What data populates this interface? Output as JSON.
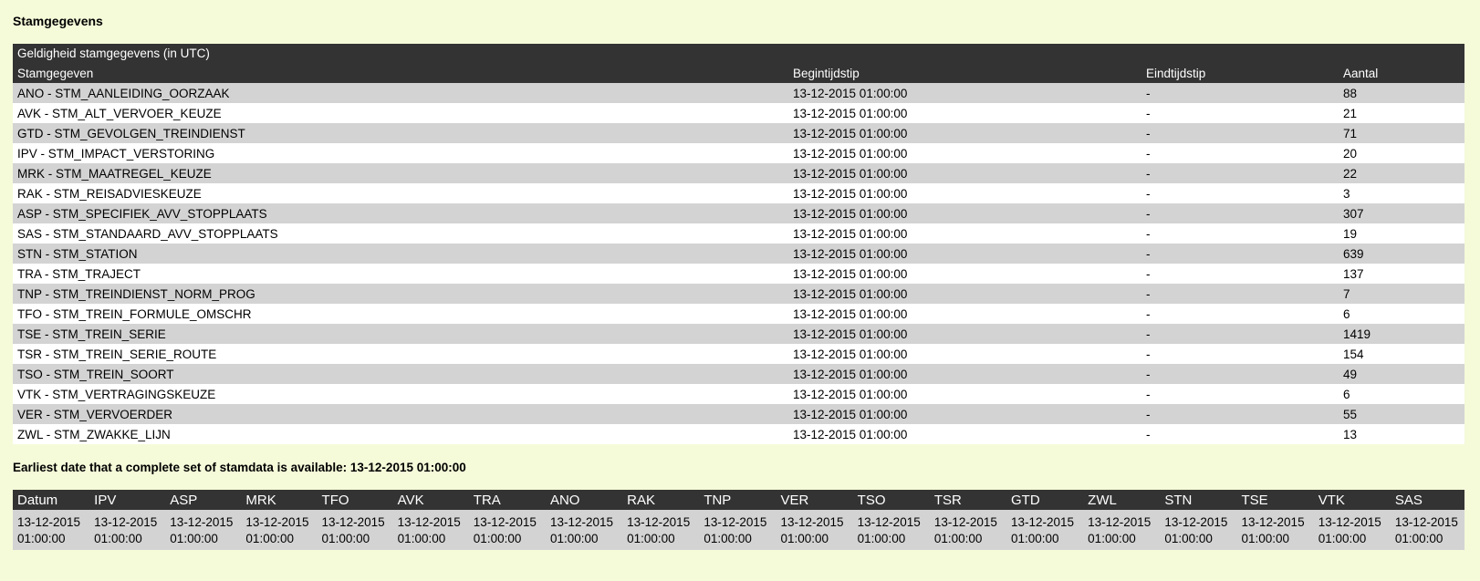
{
  "page_title": "Stamgegevens",
  "validity_table": {
    "caption": "Geldigheid stamgegevens (in UTC)",
    "columns": [
      "Stamgegeven",
      "Begintijdstip",
      "Eindtijdstip",
      "Aantal"
    ],
    "rows": [
      [
        "ANO - STM_AANLEIDING_OORZAAK",
        "13-12-2015 01:00:00",
        "-",
        "88"
      ],
      [
        "AVK - STM_ALT_VERVOER_KEUZE",
        "13-12-2015 01:00:00",
        "-",
        "21"
      ],
      [
        "GTD - STM_GEVOLGEN_TREINDIENST",
        "13-12-2015 01:00:00",
        "-",
        "71"
      ],
      [
        "IPV - STM_IMPACT_VERSTORING",
        "13-12-2015 01:00:00",
        "-",
        "20"
      ],
      [
        "MRK - STM_MAATREGEL_KEUZE",
        "13-12-2015 01:00:00",
        "-",
        "22"
      ],
      [
        "RAK - STM_REISADVIESKEUZE",
        "13-12-2015 01:00:00",
        "-",
        "3"
      ],
      [
        "ASP - STM_SPECIFIEK_AVV_STOPPLAATS",
        "13-12-2015 01:00:00",
        "-",
        "307"
      ],
      [
        "SAS - STM_STANDAARD_AVV_STOPPLAATS",
        "13-12-2015 01:00:00",
        "-",
        "19"
      ],
      [
        "STN - STM_STATION",
        "13-12-2015 01:00:00",
        "-",
        "639"
      ],
      [
        "TRA - STM_TRAJECT",
        "13-12-2015 01:00:00",
        "-",
        "137"
      ],
      [
        "TNP - STM_TREINDIENST_NORM_PROG",
        "13-12-2015 01:00:00",
        "-",
        "7"
      ],
      [
        "TFO - STM_TREIN_FORMULE_OMSCHR",
        "13-12-2015 01:00:00",
        "-",
        "6"
      ],
      [
        "TSE - STM_TREIN_SERIE",
        "13-12-2015 01:00:00",
        "-",
        "1419"
      ],
      [
        "TSR - STM_TREIN_SERIE_ROUTE",
        "13-12-2015 01:00:00",
        "-",
        "154"
      ],
      [
        "TSO - STM_TREIN_SOORT",
        "13-12-2015 01:00:00",
        "-",
        "49"
      ],
      [
        "VTK - STM_VERTRAGINGSKEUZE",
        "13-12-2015 01:00:00",
        "-",
        "6"
      ],
      [
        "VER - STM_VERVOERDER",
        "13-12-2015 01:00:00",
        "-",
        "55"
      ],
      [
        "ZWL - STM_ZWAKKE_LIJN",
        "13-12-2015 01:00:00",
        "-",
        "13"
      ]
    ]
  },
  "earliest": {
    "label": "Earliest date that a complete set of stamdata is available:",
    "value": "13-12-2015 01:00:00"
  },
  "dates_table": {
    "columns": [
      "Datum",
      "IPV",
      "ASP",
      "MRK",
      "TFO",
      "AVK",
      "TRA",
      "ANO",
      "RAK",
      "TNP",
      "VER",
      "TSO",
      "TSR",
      "GTD",
      "ZWL",
      "STN",
      "TSE",
      "VTK",
      "SAS"
    ],
    "row": [
      "13-12-2015 01:00:00",
      "13-12-2015 01:00:00",
      "13-12-2015 01:00:00",
      "13-12-2015 01:00:00",
      "13-12-2015 01:00:00",
      "13-12-2015 01:00:00",
      "13-12-2015 01:00:00",
      "13-12-2015 01:00:00",
      "13-12-2015 01:00:00",
      "13-12-2015 01:00:00",
      "13-12-2015 01:00:00",
      "13-12-2015 01:00:00",
      "13-12-2015 01:00:00",
      "13-12-2015 01:00:00",
      "13-12-2015 01:00:00",
      "13-12-2015 01:00:00",
      "13-12-2015 01:00:00",
      "13-12-2015 01:00:00",
      "13-12-2015 01:00:00"
    ]
  }
}
